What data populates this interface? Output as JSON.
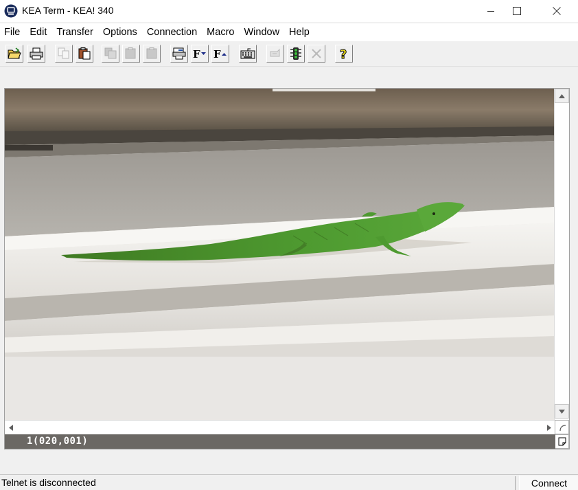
{
  "window": {
    "title": "KEA Term - KEA! 340",
    "controls": {
      "minimize": "minimize-icon",
      "maximize": "maximize-icon",
      "close": "close-icon"
    }
  },
  "menu": [
    "File",
    "Edit",
    "Transfer",
    "Options",
    "Connection",
    "Macro",
    "Window",
    "Help"
  ],
  "toolbar": {
    "buttons": [
      {
        "icon": "open-folder-icon",
        "enabled": true
      },
      {
        "icon": "printer-icon",
        "enabled": true
      },
      {
        "icon": "copy-icon",
        "enabled": false
      },
      {
        "icon": "paste-icon",
        "enabled": true
      },
      {
        "icon": "copy-table-icon",
        "enabled": false
      },
      {
        "icon": "paste-table-icon",
        "enabled": false
      },
      {
        "icon": "clipboard-icon",
        "enabled": false
      },
      {
        "icon": "print-screen-icon",
        "enabled": true
      },
      {
        "icon": "font-down-icon",
        "label": "F",
        "enabled": true
      },
      {
        "icon": "font-up-icon",
        "label": "F",
        "enabled": true
      },
      {
        "icon": "keyboard-icon",
        "enabled": true
      },
      {
        "icon": "connect-hand-icon",
        "enabled": false
      },
      {
        "icon": "traffic-light-icon",
        "enabled": true
      },
      {
        "icon": "disconnect-x-icon",
        "enabled": false
      },
      {
        "icon": "help-question-icon",
        "label": "?",
        "enabled": true
      }
    ]
  },
  "terminal": {
    "image_subject": "green-anole-lizard-on-white-railing",
    "cursor_position": "1(020,001)"
  },
  "status": {
    "message": "Telnet is disconnected",
    "connect_label": "Connect"
  },
  "colors": {
    "terminal_background": "#e9e7e4",
    "terminal_status_bar": "#6b6864",
    "lizard": "#4e9a30"
  }
}
